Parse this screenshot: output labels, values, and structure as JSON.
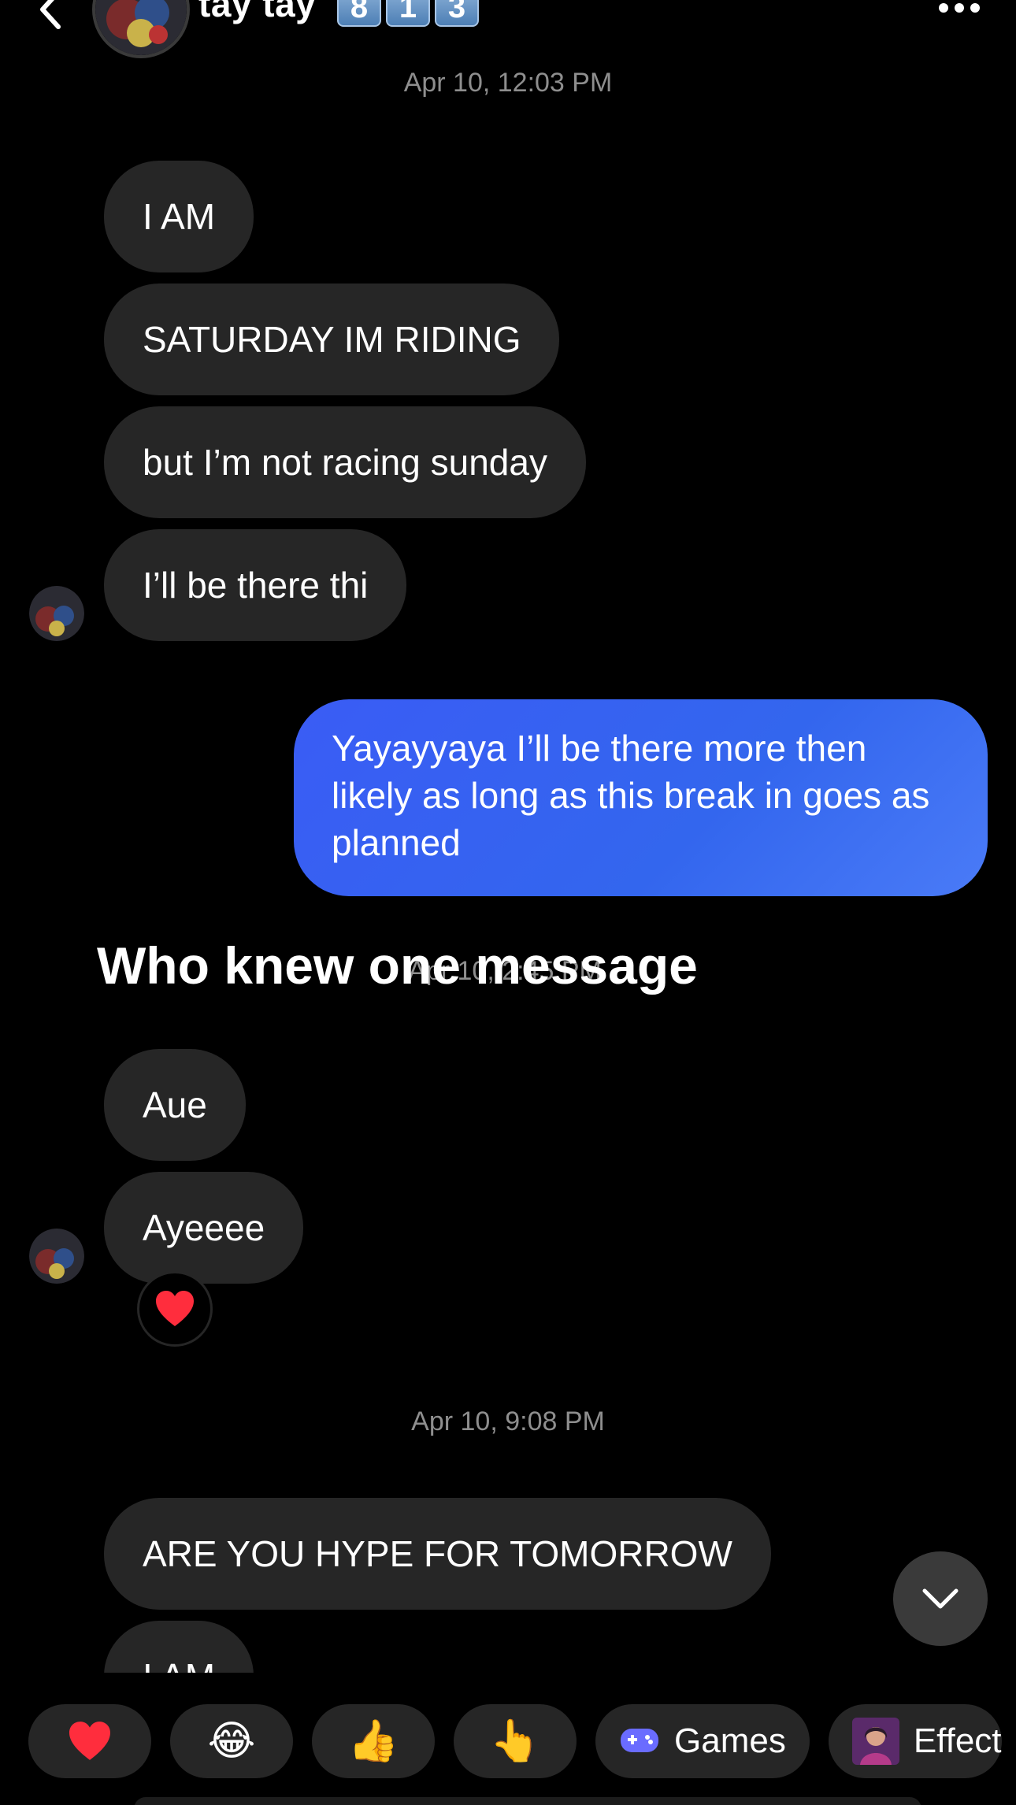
{
  "header": {
    "name": "tay tay",
    "badges": [
      "8",
      "1",
      "3"
    ]
  },
  "thread": {
    "timestamp_1": "Apr 10, 12:03 PM",
    "received_1": [
      "I AM",
      "SATURDAY IM RIDING",
      "but I’m not racing sunday",
      "I’ll be there thi"
    ],
    "sent_1": "Yayayyaya I’ll be there more then likely as long as this break in goes as planned",
    "timestamp_2": "Apr 10, 2:45 PM",
    "overlay_caption": "Who knew one message",
    "received_2": [
      "Aue",
      "Ayeeee"
    ],
    "reaction_emoji": "❤️",
    "timestamp_3": "Apr 10, 9:08 PM",
    "received_3": [
      "ARE YOU HYPE FOR TOMORROW",
      "I AM"
    ]
  },
  "quick_replies": [
    {
      "emoji": "❤️",
      "label": ""
    },
    {
      "emoji": "😂",
      "label": ""
    },
    {
      "emoji": "👍",
      "label": ""
    },
    {
      "emoji": "👆",
      "label": ""
    },
    {
      "emoji": "",
      "label": "Games"
    },
    {
      "emoji": "",
      "label": "Effect"
    }
  ],
  "colors": {
    "background": "#000000",
    "bubble_received": "#262626",
    "bubble_sent": "#3a5cf5",
    "timestamp": "#8e8e8e"
  },
  "icons": [
    "back-chevron-icon",
    "more-options-icon",
    "chevron-down-icon",
    "gamepad-icon"
  ]
}
